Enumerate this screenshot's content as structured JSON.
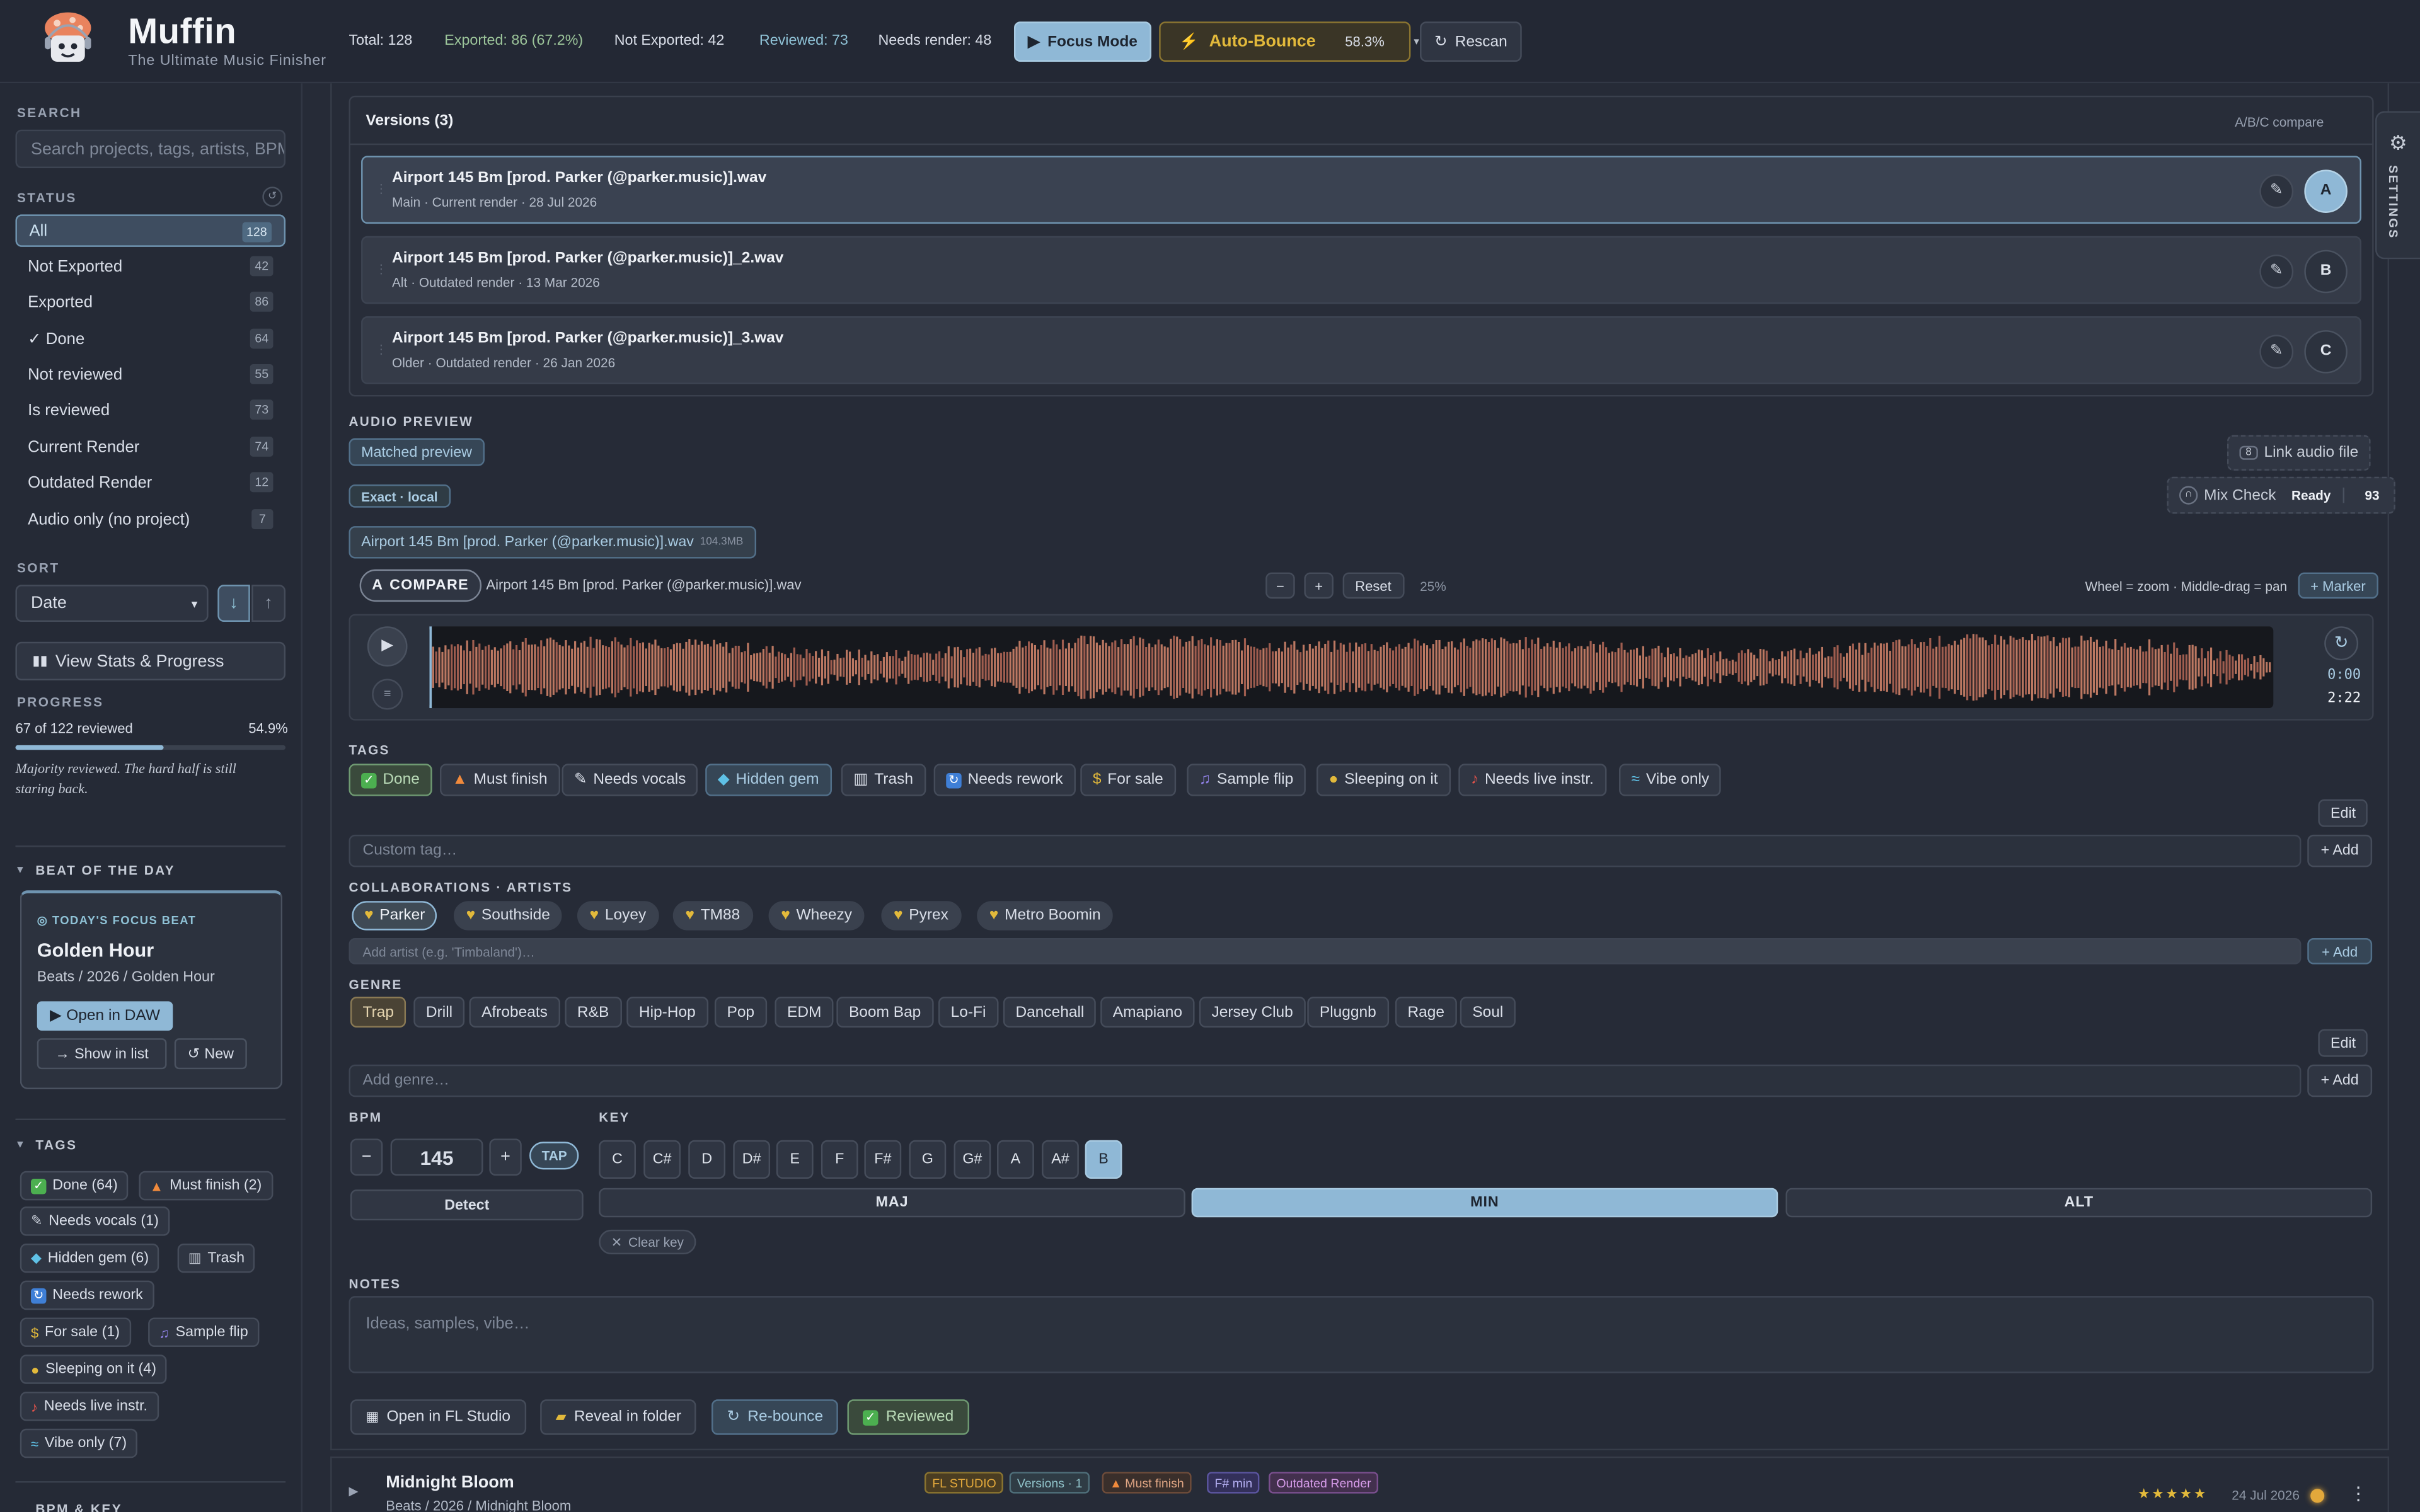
{
  "app": {
    "name": "Muffin",
    "tagline": "The Ultimate Music Finisher"
  },
  "header": {
    "total": "Total: 128",
    "exported": "Exported: 86 (67.2%)",
    "not_exported": "Not Exported: 42",
    "reviewed": "Reviewed: 73",
    "needs_render": "Needs render: 48",
    "focus_mode": "Focus Mode",
    "auto_bounce": "Auto-Bounce",
    "auto_bounce_pct": "58.3%",
    "rescan": "Rescan"
  },
  "sidebar": {
    "search_label": "SEARCH",
    "search_placeholder": "Search projects, tags, artists, BPM…",
    "status_label": "STATUS",
    "status_items": [
      {
        "label": "All",
        "count": "128"
      },
      {
        "label": "Not Exported",
        "count": "42"
      },
      {
        "label": "Exported",
        "count": "86"
      },
      {
        "label": "✓ Done",
        "count": "64"
      },
      {
        "label": "Not reviewed",
        "count": "55"
      },
      {
        "label": "Is reviewed",
        "count": "73"
      },
      {
        "label": "Current Render",
        "count": "74"
      },
      {
        "label": "Outdated Render",
        "count": "12"
      },
      {
        "label": "Audio only (no project)",
        "count": "7"
      }
    ],
    "sort_label": "SORT",
    "sort_value": "Date",
    "stats_button": "View Stats & Progress",
    "progress_label": "PROGRESS",
    "progress_text": "67 of 122 reviewed",
    "progress_pct_text": "54.9%",
    "progress_value": 0.549,
    "progress_note": "Majority reviewed. The hard half is still staring back.",
    "beat_label": "BEAT OF THE DAY",
    "focus_label": "TODAY'S FOCUS BEAT",
    "beat_title": "Golden Hour",
    "beat_path": "Beats / 2026 / Golden Hour",
    "open_daw": "Open in DAW",
    "show_in_list": "Show in list",
    "new": "New",
    "tags_label": "TAGS",
    "tags": [
      "Done (64)",
      "Must finish (2)",
      "Needs vocals (1)",
      "Hidden gem (6)",
      "Trash",
      "Needs rework",
      "For sale (1)",
      "Sample flip",
      "Sleeping on it (4)",
      "Needs live instr.",
      "Vibe only (7)"
    ],
    "bpm_key_label": "BPM & KEY"
  },
  "versions": {
    "title": "Versions (3)",
    "compare_hint": "A/B/C compare",
    "items": [
      {
        "name": "Airport 145 Bm [prod. Parker (@parker.music)].wav",
        "sub": "Main · Current render · 28 Jul 2026",
        "slot": "A"
      },
      {
        "name": "Airport 145 Bm [prod. Parker (@parker.music)]_2.wav",
        "sub": "Alt · Outdated render · 13 Mar 2026",
        "slot": "B"
      },
      {
        "name": "Airport 145 Bm [prod. Parker (@parker.music)]_3.wav",
        "sub": "Older · Outdated render · 26 Jan 2026",
        "slot": "C"
      }
    ]
  },
  "audio": {
    "label": "AUDIO PREVIEW",
    "matched": "Matched preview",
    "link_audio": "Link audio file",
    "exact": "Exact · local",
    "mix_check": "Mix Check",
    "mix_ready": "Ready",
    "mix_score": "93",
    "file": "Airport 145 Bm [prod. Parker (@parker.music)].wav",
    "file_size": "104.3MB",
    "compare": "COMPARE",
    "compare_file": "Airport 145 Bm [prod. Parker (@parker.music)].wav",
    "minus": "−",
    "plus": "+",
    "reset": "Reset",
    "zoom": "25%",
    "hint": "Wheel = zoom · Middle-drag = pan",
    "marker": "+ Marker",
    "time_current": "0:00",
    "time_total": "2:22"
  },
  "tags_section": {
    "label": "TAGS",
    "items": [
      "Done",
      "Must finish",
      "Needs vocals",
      "Hidden gem",
      "Trash",
      "Needs rework",
      "For sale",
      "Sample flip",
      "Sleeping on it",
      "Needs live instr.",
      "Vibe only"
    ],
    "edit": "Edit",
    "custom_placeholder": "Custom tag…",
    "add": "+ Add"
  },
  "collab": {
    "label": "COLLABORATIONS · ARTISTS",
    "artists": [
      "Parker",
      "Southside",
      "Loyey",
      "TM88",
      "Wheezy",
      "Pyrex",
      "Metro Boomin"
    ],
    "placeholder": "Add artist (e.g. 'Timbaland')…",
    "add": "+ Add"
  },
  "genre": {
    "label": "GENRE",
    "items": [
      "Trap",
      "Drill",
      "Afrobeats",
      "R&B",
      "Hip-Hop",
      "Pop",
      "EDM",
      "Boom Bap",
      "Lo-Fi",
      "Dancehall",
      "Amapiano",
      "Jersey Club",
      "Pluggnb",
      "Rage",
      "Soul"
    ],
    "edit": "Edit",
    "placeholder": "Add genre…",
    "add": "+ Add"
  },
  "bpm": {
    "label": "BPM",
    "value": "145",
    "minus": "−",
    "plus": "+",
    "tap": "TAP",
    "detect": "Detect"
  },
  "key": {
    "label": "KEY",
    "notes": [
      "C",
      "C#",
      "D",
      "D#",
      "E",
      "F",
      "F#",
      "G",
      "G#",
      "A",
      "A#",
      "B"
    ],
    "modes": [
      "MAJ",
      "MIN",
      "ALT"
    ],
    "clear": "Clear key"
  },
  "notes": {
    "label": "NOTES",
    "placeholder": "Ideas, samples, vibe…"
  },
  "actions": {
    "open_fl": "Open in FL Studio",
    "reveal": "Reveal in folder",
    "rebounce": "Re-bounce",
    "reviewed": "Reviewed"
  },
  "next_item": {
    "title": "Midnight Bloom",
    "path": "Beats / 2026 / Midnight Bloom",
    "badges": [
      "FL STUDIO",
      "Versions · 1",
      "Must finish",
      "F# min",
      "Outdated Render"
    ],
    "date": "24 Jul 2026",
    "stars": "★★★★★"
  },
  "settings_tab": "SETTINGS",
  "colors": {
    "accent": "#8fb8d6",
    "gold": "#e2b93b",
    "green": "#9cc59a"
  }
}
